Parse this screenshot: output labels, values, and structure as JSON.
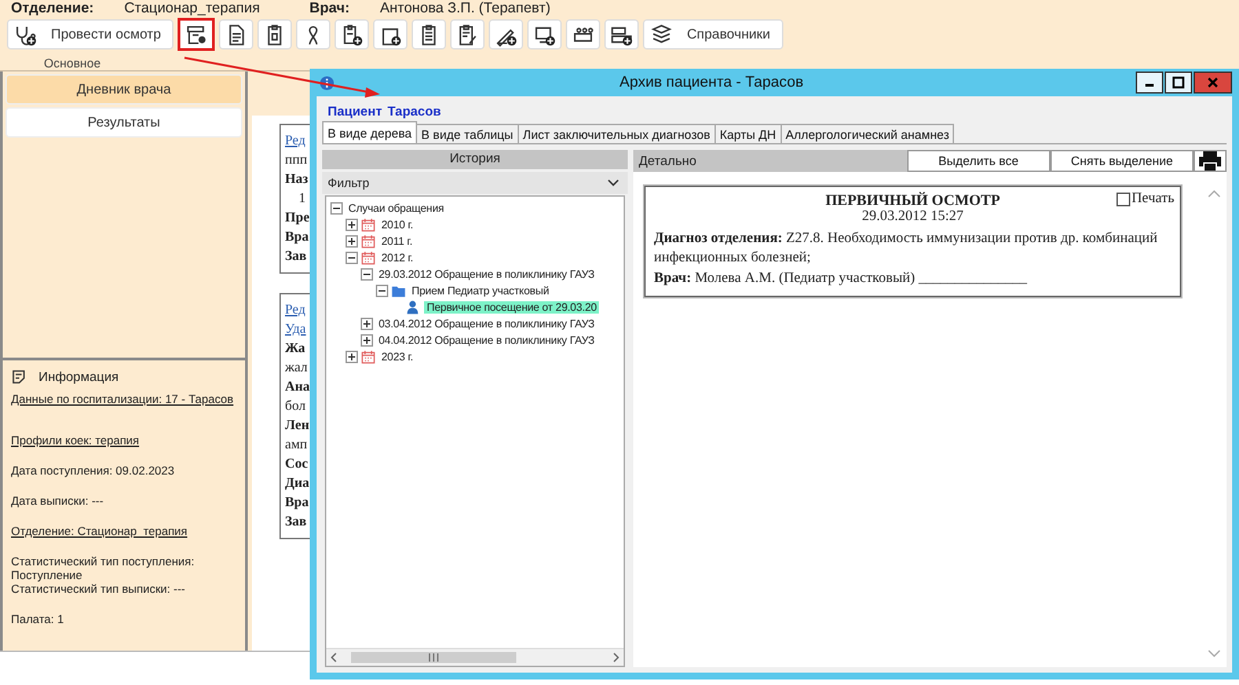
{
  "header": {
    "department_label": "Отделение:",
    "department": "Стационар_терапия",
    "doctor_label": "Врач:",
    "doctor": "Антонова  З.П. (Терапевт)"
  },
  "toolbar": {
    "group_label": "Основное",
    "buttons": [
      {
        "kind": "labeled",
        "label": "Провести осмотр",
        "highlighted": false
      },
      {
        "kind": "icon",
        "highlighted": true
      },
      {
        "kind": "icon",
        "highlighted": false
      },
      {
        "kind": "icon",
        "highlighted": false
      },
      {
        "kind": "icon",
        "highlighted": false
      },
      {
        "kind": "icon",
        "highlighted": false
      },
      {
        "kind": "icon",
        "highlighted": false
      },
      {
        "kind": "icon",
        "highlighted": false
      },
      {
        "kind": "icon",
        "highlighted": false
      },
      {
        "kind": "icon",
        "highlighted": false
      },
      {
        "kind": "icon",
        "highlighted": false
      },
      {
        "kind": "icon",
        "highlighted": false
      },
      {
        "kind": "icon",
        "highlighted": false
      },
      {
        "kind": "labeled",
        "label": "Справочники",
        "highlighted": false
      }
    ]
  },
  "sidebar": {
    "tabs": [
      {
        "label": "Дневник врача",
        "selected": true
      },
      {
        "label": "Результаты",
        "selected": false
      }
    ],
    "info": {
      "title": "Информация",
      "items": [
        {
          "kind": "link",
          "text": "Данные по госпитализации: 17 - Тарасов"
        },
        {
          "kind": "link",
          "text": "Профили коек: терапия"
        },
        {
          "kind": "text",
          "text": "Дата поступления: 09.02.2023"
        },
        {
          "kind": "text",
          "text": "Дата выписки: ---"
        },
        {
          "kind": "link",
          "text": "Отделение: Стационар_терапия"
        },
        {
          "kind": "text",
          "text": "Статистический тип поступления: Поступление"
        },
        {
          "kind": "tight",
          "text": "Статистический тип выписки: ---"
        },
        {
          "kind": "text",
          "text": "Палата: 1"
        }
      ]
    }
  },
  "journal": {
    "cards": [
      {
        "lines": [
          {
            "kind": "link",
            "text": "Ред"
          },
          {
            "kind": "text",
            "text": "ппп"
          },
          {
            "kind": "bold",
            "text": "Наз"
          },
          {
            "kind": "indent",
            "text": "1"
          },
          {
            "kind": "bold",
            "text": "Пре"
          },
          {
            "kind": "bold",
            "text": "Вра"
          },
          {
            "kind": "bold",
            "text": "Зав"
          }
        ]
      },
      {
        "lines": [
          {
            "kind": "link",
            "text": "Ред"
          },
          {
            "kind": "link",
            "text": "Уда"
          },
          {
            "kind": "bold",
            "text": "Жа"
          },
          {
            "kind": "text",
            "text": "жал"
          },
          {
            "kind": "bold",
            "text": "Ана"
          },
          {
            "kind": "text",
            "text": "бол"
          },
          {
            "kind": "bold",
            "text": "Лен"
          },
          {
            "kind": "text",
            "text": "амп"
          },
          {
            "kind": "bold",
            "text": "Сос"
          },
          {
            "kind": "bold",
            "text": "Диа"
          },
          {
            "kind": "bold",
            "text": "Вра"
          },
          {
            "kind": "bold",
            "text": "Зав"
          }
        ]
      }
    ]
  },
  "dialog": {
    "title": "Архив пациента - Тарасов",
    "patient_label": "Пациент",
    "patient_name": "Тарасов",
    "tabs": [
      {
        "label": "В виде дерева",
        "selected": true
      },
      {
        "label": "В виде таблицы",
        "selected": false
      },
      {
        "label": "Лист заключительных диагнозов",
        "selected": false
      },
      {
        "label": "Карты ДН",
        "selected": false
      },
      {
        "label": "Аллергологический анамнез",
        "selected": false
      }
    ],
    "history": {
      "title": "История",
      "filter": "Фильтр",
      "tree": [
        {
          "label": "Случаи обращения",
          "expanded": true,
          "selected": false,
          "children": [
            {
              "kind": "year",
              "label": "2010 г.",
              "expanded": false,
              "selected": false
            },
            {
              "kind": "year",
              "label": "2011 г.",
              "expanded": false,
              "selected": false
            },
            {
              "kind": "year",
              "label": "2012 г.",
              "expanded": true,
              "selected": false,
              "children": [
                {
                  "label": "29.03.2012 Обращение в поликлинику ГАУЗ",
                  "expanded": true,
                  "selected": false,
                  "children": [
                    {
                      "kind": "reception",
                      "label": "Прием Педиатр участковый",
                      "expanded": true,
                      "selected": false,
                      "children": [
                        {
                          "kind": "visit",
                          "label": "Первичное посещение от 29.03.20",
                          "selected": true
                        }
                      ]
                    }
                  ]
                },
                {
                  "label": "03.04.2012 Обращение в поликлинику ГАУЗ",
                  "expanded": false,
                  "selected": false
                },
                {
                  "label": "04.04.2012 Обращение в поликлинику ГАУЗ",
                  "expanded": false,
                  "selected": false
                }
              ]
            },
            {
              "kind": "year",
              "label": "2023 г.",
              "expanded": false,
              "selected": false
            }
          ]
        }
      ]
    },
    "detail": {
      "title": "Детально",
      "buttons": [
        "Выделить все",
        "Снять выделение"
      ],
      "document": {
        "title": "ПЕРВИЧНЫЙ ОСМОТР",
        "datetime": "29.03.2012 15:27",
        "print_label": "Печать",
        "print_checked": false,
        "lines": [
          "**Диагноз отделения:** Z27.8. Необходимость иммунизации против др. комбинаций инфекционных болезней;",
          "**Врач:** Молева А.М. (Педиатр участковый) _______________"
        ]
      }
    }
  }
}
